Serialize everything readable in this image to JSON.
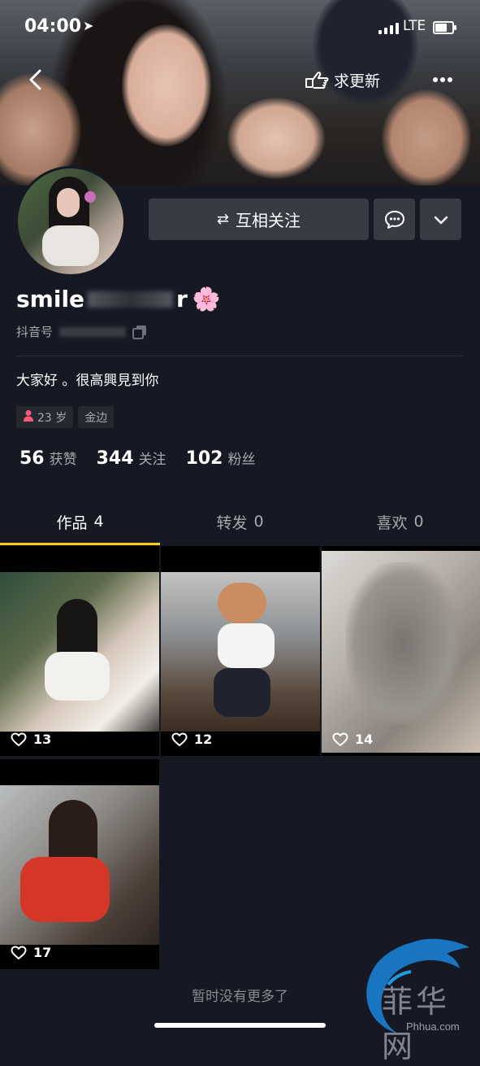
{
  "status_bar": {
    "time": "04:00",
    "network": "LTE",
    "battery_level": 0.8
  },
  "nav": {
    "more_label": "求更新"
  },
  "profile": {
    "follow_label": "互相关注",
    "username": "smile",
    "username_tail": "r",
    "username_emoji": "🌸",
    "uid_label": "抖音号",
    "bio": "大家好 。很高興見到你",
    "tags": [
      {
        "icon": "female-icon",
        "label": "23 岁"
      },
      {
        "label": "金边"
      }
    ],
    "stats": [
      {
        "value": "56",
        "label": "获赞"
      },
      {
        "value": "344",
        "label": "关注"
      },
      {
        "value": "102",
        "label": "粉丝"
      }
    ]
  },
  "tabs": [
    {
      "label": "作品",
      "count": "4",
      "active": true
    },
    {
      "label": "转发",
      "count": "0",
      "active": false
    },
    {
      "label": "喜欢",
      "count": "0",
      "active": false
    }
  ],
  "videos": [
    {
      "likes": "13"
    },
    {
      "likes": "12"
    },
    {
      "likes": "14"
    },
    {
      "likes": "17"
    }
  ],
  "footer": {
    "text": "暂时没有更多了"
  },
  "watermark": {
    "text_cn": "菲华网",
    "text_en": "Phhua.com"
  },
  "colors": {
    "background": "#161823",
    "accent": "#face15",
    "button": "#393b44"
  }
}
